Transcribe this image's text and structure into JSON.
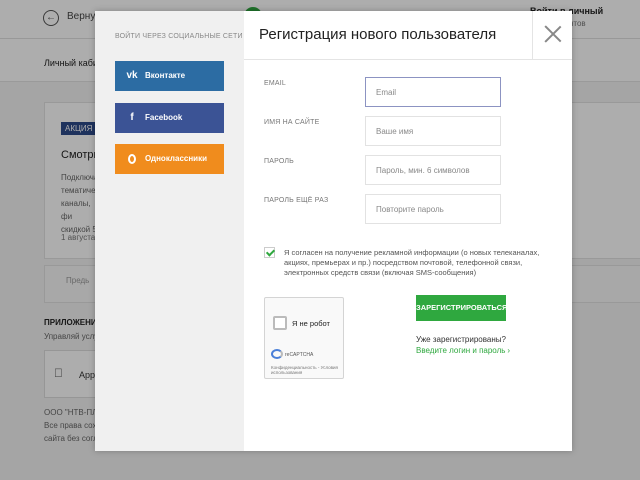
{
  "background": {
    "back_label": "Вернуть",
    "cabinet_title": "Войти в личный кабинет",
    "cabinet_sub": "Для абонентов",
    "subheader": "Личный кабин",
    "badge": "АКЦИЯ",
    "card_title": "Смотри",
    "card_text": "Подключа тематическ каналы, фи скидкой 5",
    "card_date": "1 августа",
    "pager": "Предь",
    "app_header": "ПРИЛОЖЕНИЕ",
    "app_sub": "Управляй услуг",
    "app_label": "App",
    "footer1": "ООО \"НТВ-ПЛЮ",
    "footer2": "Все права сохр",
    "footer3": "сайта без соглас"
  },
  "modal": {
    "title": "Регистрация нового пользователя",
    "social_title": "ВОЙТИ ЧЕРЕЗ СОЦИАЛЬНЫЕ СЕТИ",
    "social": {
      "vk": "Вконтакте",
      "fb": "Facebook",
      "ok": "Одноклассники"
    },
    "fields": {
      "email_label": "EMAIL",
      "email_placeholder": "Email",
      "name_label": "ИМЯ НА САЙТЕ",
      "name_placeholder": "Ваше имя",
      "password_label": "ПАРОЛЬ",
      "password_placeholder": "Пароль, мин. 6 символов",
      "password2_label": "ПАРОЛЬ ЕЩЁ РАЗ",
      "password2_placeholder": "Повторите пароль"
    },
    "consent": "Я согласен на получение рекламной информации (о новых телеканалах, акциях, премьерах и пр.) посредством почтовой, телефонной связи, электронных средств связи (включая SMS-сообщения)",
    "captcha": {
      "label": "Я не робот",
      "brand": "reCAPTCHA",
      "links": "Конфиденциальность - Условия использования"
    },
    "register_label": "ЗАРЕГИСТРИРОВАТЬСЯ",
    "already_text": "Уже зарегистрированы?",
    "login_link": "Введите логин и пароль"
  },
  "colors": {
    "accent_green": "#2fa83f",
    "vk_blue": "#2c6ca3",
    "fb_blue": "#3b5395",
    "ok_orange": "#f08c1d"
  }
}
